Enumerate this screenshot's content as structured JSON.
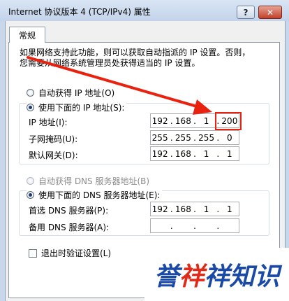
{
  "window": {
    "title": "Internet 协议版本 4 (TCP/IPv4) 属性",
    "help_label": "?",
    "close_label": "✕"
  },
  "tabs": [
    {
      "label": "常规"
    }
  ],
  "description": {
    "line1": "如果网络支持此功能，则可以获取自动指派的 IP 设置。否则，",
    "line2": "您需要从网络系统管理员处获得适当的 IP 设置。"
  },
  "ip_section": {
    "auto_radio": {
      "label": "自动获得 IP 地址(O)",
      "checked": false
    },
    "manual_radio": {
      "label": "使用下面的 IP 地址(S):",
      "checked": true
    },
    "ip_address": {
      "label": "IP 地址(I):",
      "octets": [
        "192",
        "168",
        "1",
        "200"
      ]
    },
    "subnet_mask": {
      "label": "子网掩码(U):",
      "octets": [
        "255",
        "255",
        "255",
        "0"
      ]
    },
    "gateway": {
      "label": "默认网关(D):",
      "octets": [
        "192",
        "168",
        "1",
        "1"
      ]
    }
  },
  "dns_section": {
    "auto_radio": {
      "label": "自动获得 DNS 服务器地址(B)",
      "checked": false,
      "disabled": true
    },
    "manual_radio": {
      "label": "使用下面的 DNS 服务器地址(E):",
      "checked": true
    },
    "preferred": {
      "label": "首选 DNS 服务器(P):",
      "octets": [
        "192",
        "168",
        "1",
        "1"
      ]
    },
    "alternate": {
      "label": "备用 DNS 服务器(A):",
      "octets": [
        "",
        "",
        "",
        ""
      ]
    }
  },
  "validate_checkbox": {
    "label": "退出时验证设置(L)",
    "checked": false
  },
  "watermark": {
    "part1": "誉",
    "part2": "祥",
    "part3": "祥知识"
  },
  "colors": {
    "annotation": "#e8220e",
    "watermark_blue": "#1b4aa6",
    "watermark_red": "#e02a1a"
  }
}
